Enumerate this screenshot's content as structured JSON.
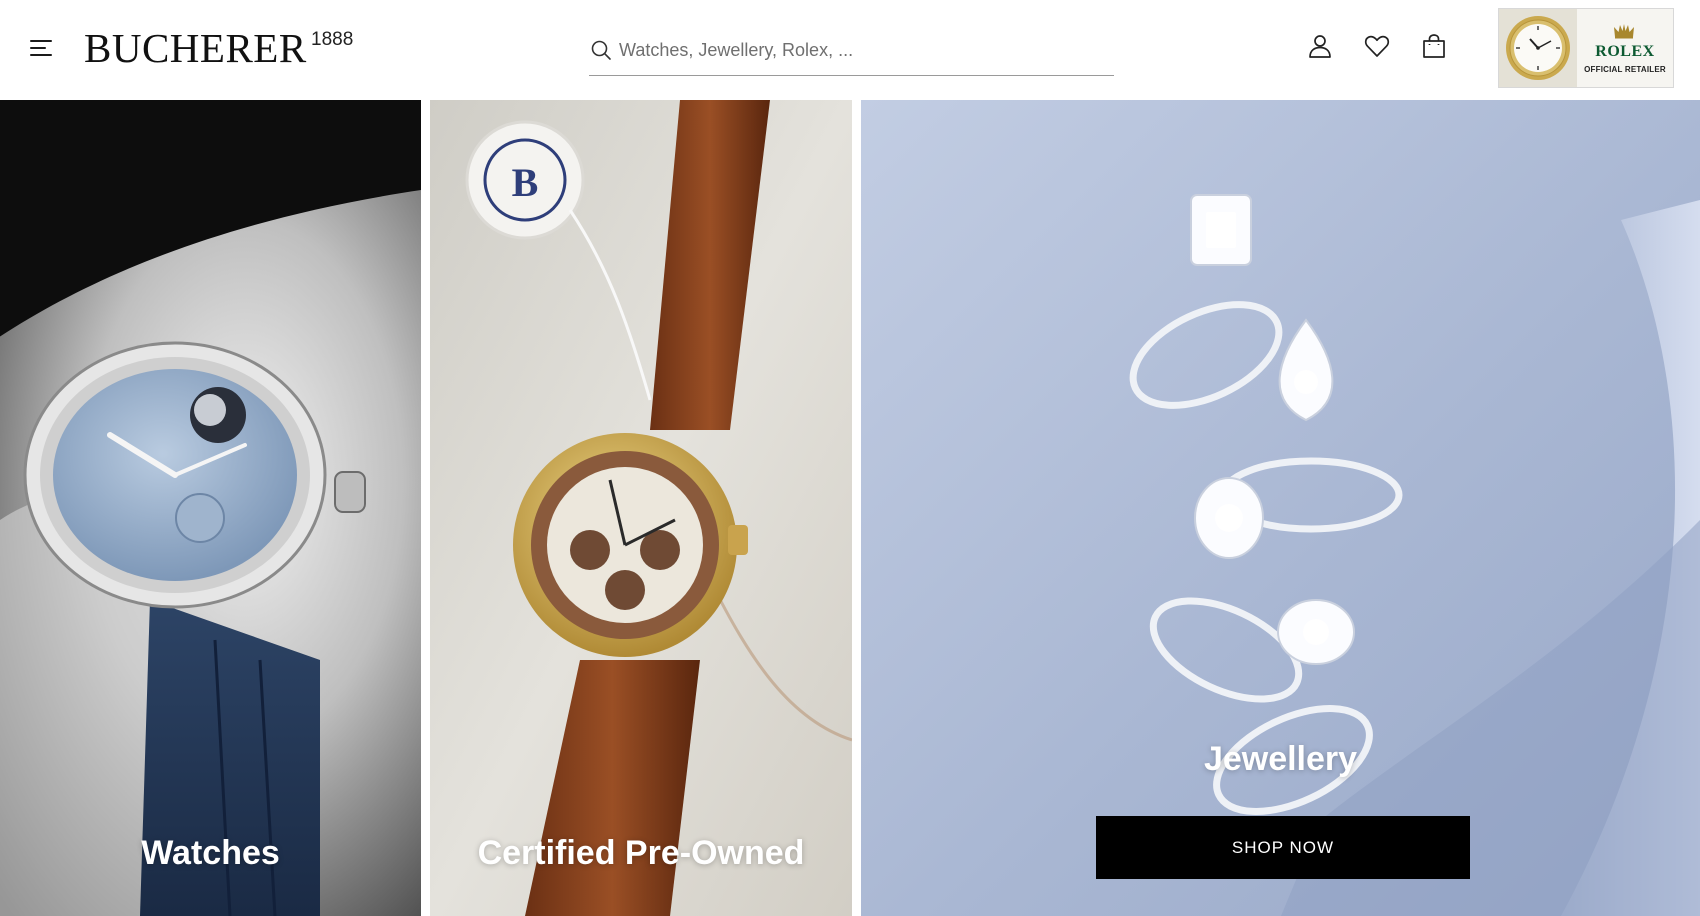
{
  "header": {
    "menu_icon": "hamburger-menu-icon",
    "logo": {
      "name": "BUCHERER",
      "year": "1888"
    },
    "search": {
      "placeholder": "Watches, Jewellery, Rolex, ...",
      "value": "",
      "icon": "search-icon"
    },
    "icons": [
      "user-icon",
      "heart-icon",
      "shopping-bag-icon"
    ],
    "rolex_badge": {
      "name": "ROLEX",
      "subtitle": "OFFICIAL RETAILER",
      "brand_color": "#0d5a32"
    }
  },
  "tiles": [
    {
      "label": "Watches",
      "bg_color": "#9aa8bd"
    },
    {
      "label": "Certified Pre-Owned",
      "bg_color": "#d8d6cf"
    },
    {
      "label": "Jewellery",
      "bg_color": "#aebad5",
      "button": "SHOP NOW"
    }
  ]
}
